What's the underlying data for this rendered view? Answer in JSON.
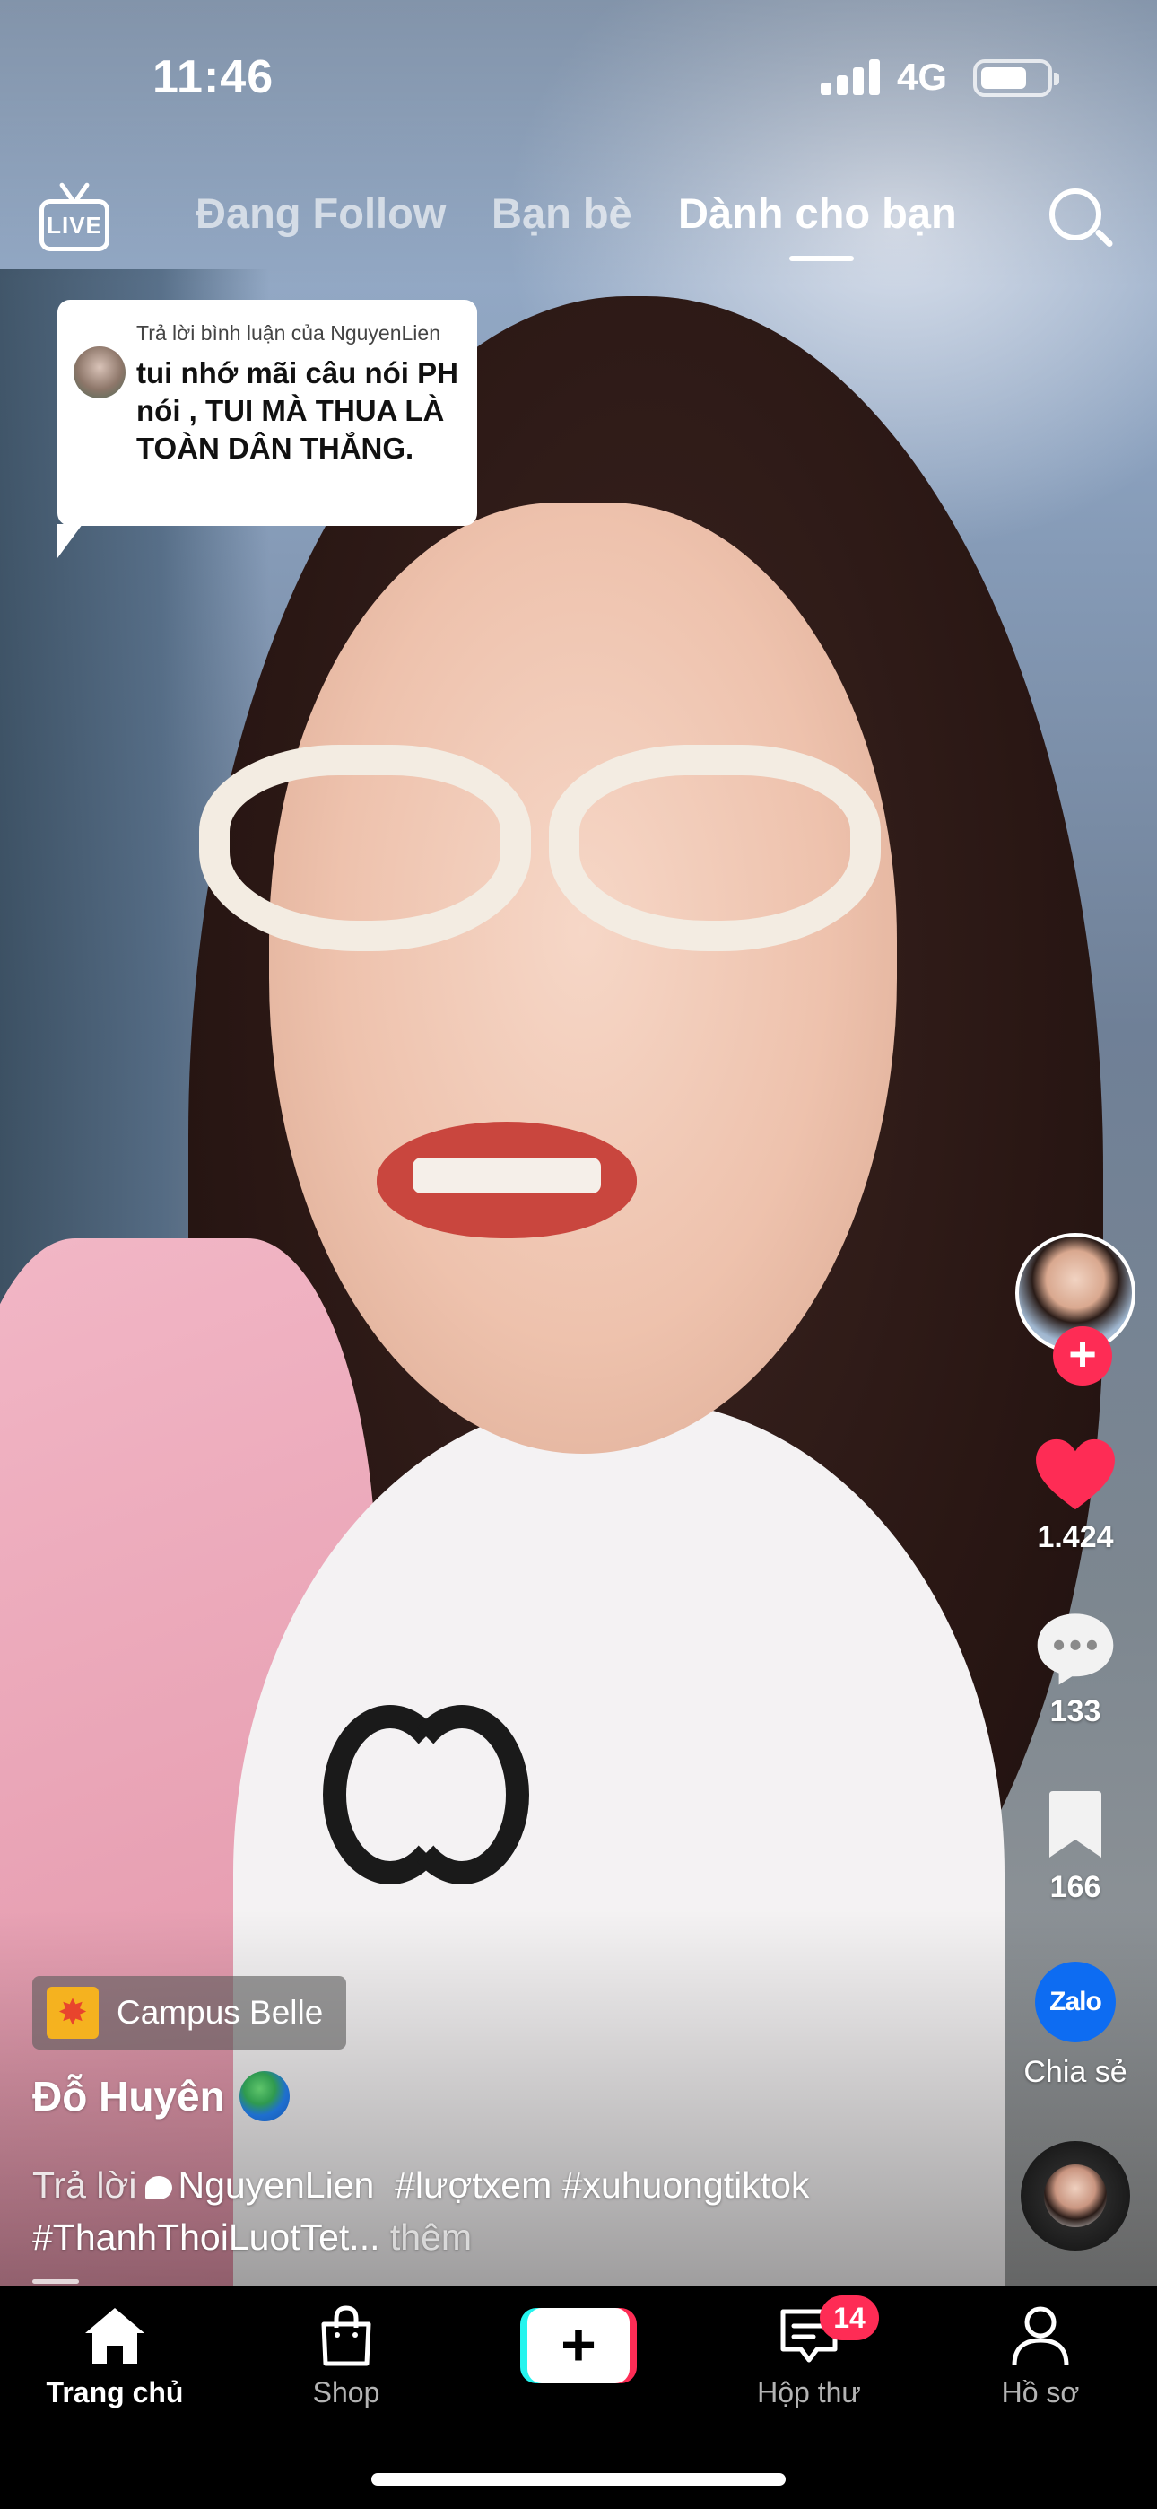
{
  "status_bar": {
    "time": "11:46",
    "network": "4G",
    "battery_level": 0.72
  },
  "top_nav": {
    "live_label": "LIVE",
    "tabs": [
      {
        "label": "Đang Follow",
        "active": false
      },
      {
        "label": "Bạn bè",
        "active": false
      },
      {
        "label": "Dành cho bạn",
        "active": true
      }
    ],
    "search_icon": "search-icon"
  },
  "reply_sticker": {
    "header": "Trả lời bình luận của NguyenLien",
    "text": "tui nhớ mãi câu nói PH nói , TUI MÀ THUA LÀ TOÀN DÂN THẮNG."
  },
  "actions": {
    "likes": "1.424",
    "comments": "133",
    "bookmarks": "166",
    "share_app": "Zalo",
    "share_label": "Chia sẻ"
  },
  "post": {
    "effect_label": "Campus Belle",
    "username": "Đỗ Huyên",
    "caption_prefix": "Trả lời",
    "mention": "NguyenLien",
    "caption_rest": "#lượtxem #xuhuongtiktok #ThanhThoiLuotTet...",
    "more_label": "thêm"
  },
  "tab_bar": {
    "items": [
      {
        "label": "Trang chủ",
        "icon": "home-icon",
        "active": true
      },
      {
        "label": "Shop",
        "icon": "shop-bag-icon",
        "active": false
      },
      {
        "label": "",
        "icon": "create-plus-icon",
        "active": false
      },
      {
        "label": "Hộp thư",
        "icon": "inbox-icon",
        "active": false,
        "badge": "14"
      },
      {
        "label": "Hồ sơ",
        "icon": "profile-icon",
        "active": false
      }
    ]
  },
  "colors": {
    "accent": "#fe2c55",
    "cyan": "#25f4ee",
    "zalo": "#0d6cf2"
  }
}
